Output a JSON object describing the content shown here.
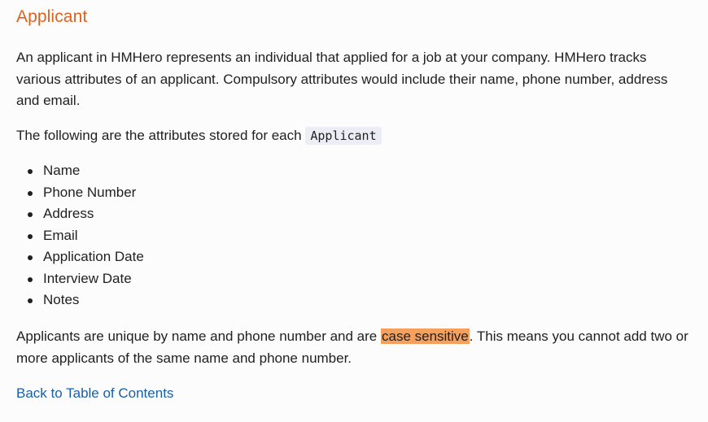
{
  "heading": "Applicant",
  "intro": "An applicant in HMHero represents an individual that applied for a job at your company. HMHero tracks various attributes of an applicant. Compulsory attributes would include their name, phone number, address and email.",
  "attributes_intro": "The following are the attributes stored for each",
  "attributes_code": "Applicant",
  "attributes": [
    "Name",
    "Phone Number",
    "Address",
    "Email",
    "Application Date",
    "Interview Date",
    "Notes"
  ],
  "uniqueness": {
    "before": "Applicants are unique by name and phone number and are ",
    "highlight": "case sensitive",
    "after": ". This means you cannot add two or more applicants of the same name and phone number."
  },
  "back_link": "Back to Table of Contents",
  "colors": {
    "heading": "#e0611e",
    "link": "#1a5fa6",
    "highlight": "#f6a05e"
  }
}
